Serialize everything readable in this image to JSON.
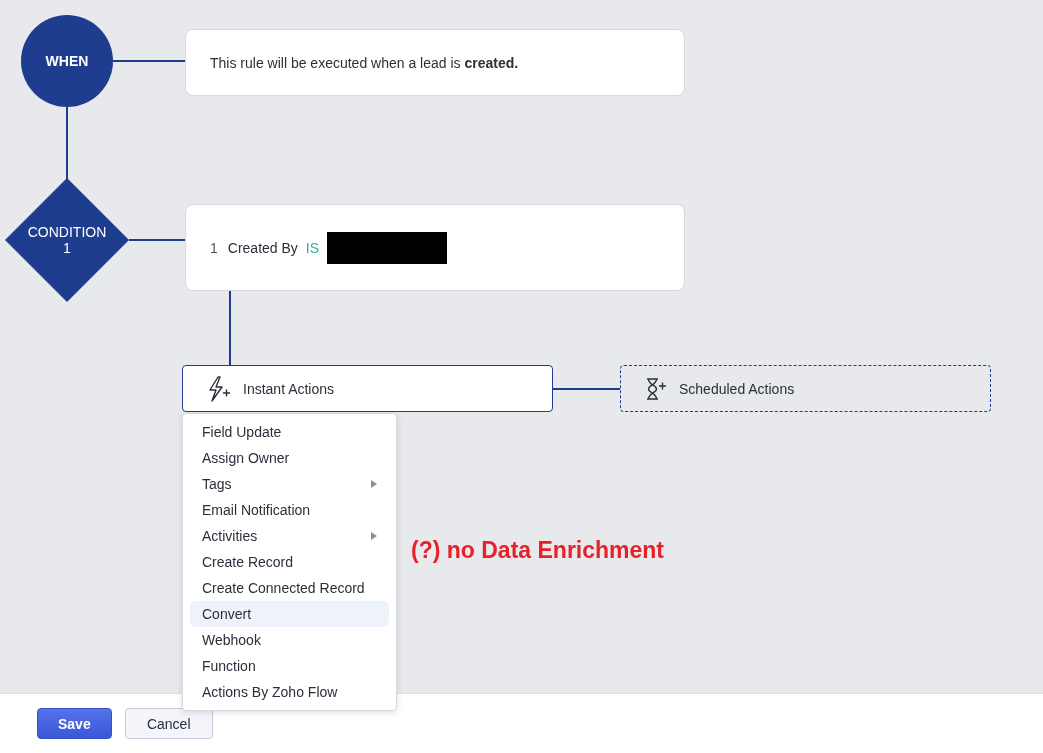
{
  "trigger": {
    "label": "WHEN",
    "text": "This rule will be executed when a lead is **created.**"
  },
  "condition": {
    "label": "CONDITION\n1",
    "number": "1",
    "field": "Created By",
    "operator": "IS"
  },
  "instant_actions": {
    "label": "Instant Actions",
    "expanded": true
  },
  "scheduled_actions": {
    "label": "Scheduled Actions"
  },
  "menu": [
    {
      "label": "Field Update",
      "has_submenu": false,
      "selected": false
    },
    {
      "label": "Assign Owner",
      "has_submenu": false,
      "selected": false
    },
    {
      "label": "Tags",
      "has_submenu": true,
      "selected": false
    },
    {
      "label": "Email Notification",
      "has_submenu": false,
      "selected": false
    },
    {
      "label": "Activities",
      "has_submenu": true,
      "selected": false
    },
    {
      "label": "Create Record",
      "has_submenu": false,
      "selected": false
    },
    {
      "label": "Create Connected Record",
      "has_submenu": false,
      "selected": false
    },
    {
      "label": "Convert",
      "has_submenu": false,
      "selected": true
    },
    {
      "label": "Webhook",
      "has_submenu": false,
      "selected": false
    },
    {
      "label": "Function",
      "has_submenu": false,
      "selected": false
    },
    {
      "label": "Actions By Zoho Flow",
      "has_submenu": false,
      "selected": false
    }
  ],
  "annotation": "(?) no Data Enrichment",
  "buttons": [
    {
      "label": "Save",
      "kind": "primary"
    },
    {
      "label": "Cancel",
      "kind": "secondary"
    }
  ]
}
